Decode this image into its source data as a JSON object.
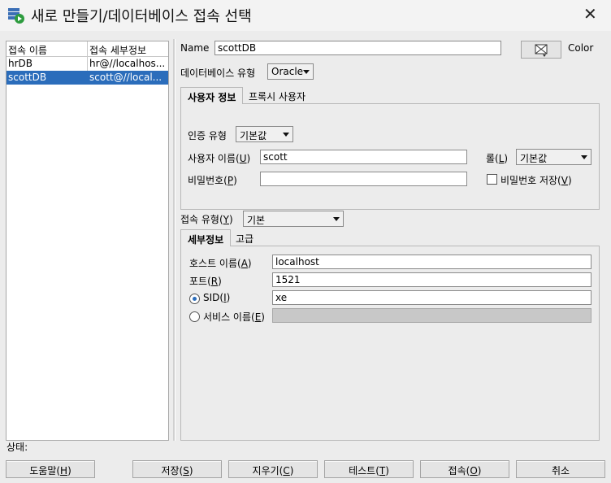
{
  "window": {
    "title": "새로 만들기/데이터베이스 접속 선택"
  },
  "connections": {
    "headers": [
      "접속 이름",
      "접속 세부정보"
    ],
    "rows": [
      {
        "name": "hrDB",
        "details": "hr@//localhos..."
      },
      {
        "name": "scottDB",
        "details": "scott@//local..."
      }
    ],
    "selected": "scottDB"
  },
  "name": {
    "label": "Name",
    "value": "scottDB"
  },
  "color": {
    "label": "Color"
  },
  "db_type": {
    "label": "데이터베이스 유형",
    "value": "Oracle"
  },
  "user_tabs": {
    "tabs": [
      "사용자 정보",
      "프록시 사용자"
    ],
    "active": 0
  },
  "auth": {
    "label": "인증 유형",
    "value": "기본값"
  },
  "username": {
    "label": "사용자 이름(U)",
    "label_main": "사용자 이름(",
    "mnemonic": "U",
    "label_end": ")",
    "value": "scott"
  },
  "role": {
    "label_main": "롤(",
    "mnemonic": "L",
    "label_end": ")",
    "value": "기본값"
  },
  "password": {
    "label_main": "비밀번호(",
    "mnemonic": "P",
    "label_end": ")",
    "value": ""
  },
  "save_password": {
    "label_main": "비밀번호 저장(",
    "mnemonic": "V",
    "label_end": ")",
    "checked": false
  },
  "conn_type": {
    "label_main": "접속 유형(",
    "mnemonic": "Y",
    "label_end": ")",
    "value": "기본"
  },
  "detail_tabs": {
    "tabs": [
      "세부정보",
      "고급"
    ],
    "active": 0
  },
  "hostname": {
    "label_main": "호스트 이름(",
    "mnemonic": "A",
    "label_end": ")",
    "value": "localhost"
  },
  "port": {
    "label_main": "포트(",
    "mnemonic": "R",
    "label_end": ")",
    "value": "1521"
  },
  "sid": {
    "label_main": "SID(",
    "mnemonic": "I",
    "label_end": ")",
    "value": "xe",
    "selected": true
  },
  "service_name": {
    "label_main": "서비스 이름(",
    "mnemonic": "E",
    "label_end": ")",
    "value": "",
    "selected": false
  },
  "status": {
    "label": "상태:"
  },
  "buttons": {
    "help": {
      "main": "도움말(",
      "mnemonic": "H",
      "end": ")"
    },
    "save": {
      "main": "저장(",
      "mnemonic": "S",
      "end": ")"
    },
    "clear": {
      "main": "지우기(",
      "mnemonic": "C",
      "end": ")"
    },
    "test": {
      "main": "테스트(",
      "mnemonic": "T",
      "end": ")"
    },
    "connect": {
      "main": "접속(",
      "mnemonic": "O",
      "end": ")"
    },
    "cancel": {
      "label": "취소"
    }
  },
  "colors": {
    "selection": "#2b6dbb",
    "window_bg": "#ececec"
  }
}
